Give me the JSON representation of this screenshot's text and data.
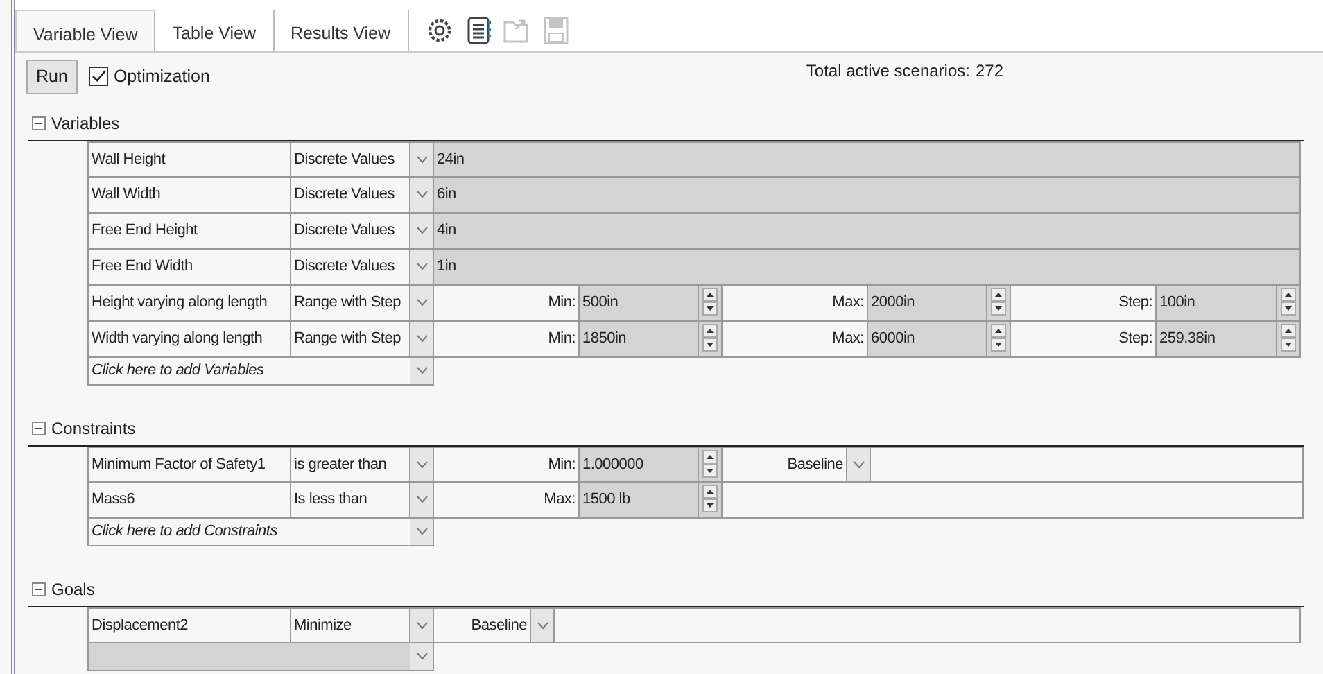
{
  "tabs": [
    {
      "label": "Variable View",
      "selected": true
    },
    {
      "label": "Table View",
      "selected": false
    },
    {
      "label": "Results View",
      "selected": false
    }
  ],
  "toolbar": [
    {
      "kind": "settings",
      "disabled": false
    },
    {
      "kind": "notes",
      "disabled": false
    },
    {
      "kind": "export",
      "disabled": true
    },
    {
      "kind": "save",
      "disabled": true
    }
  ],
  "run_button": "Run",
  "optimization": {
    "label": "Optimization",
    "checked": true
  },
  "total_scenarios": {
    "label": "Total active scenarios:",
    "value": "272"
  },
  "sections": [
    {
      "title": "Variables",
      "expanded": true,
      "rows": [
        {
          "kind": "discrete",
          "name": "Wall Height",
          "type": "Discrete Values",
          "value": "24in"
        },
        {
          "kind": "discrete",
          "name": "Wall Width",
          "type": "Discrete Values",
          "value": "6in"
        },
        {
          "kind": "discrete",
          "name": "Free End Height",
          "type": "Discrete Values",
          "value": "4in"
        },
        {
          "kind": "discrete",
          "name": "Free End Width",
          "type": "Discrete Values",
          "value": "1in"
        },
        {
          "kind": "range",
          "name": "Height varying along length",
          "type": "Range with Step",
          "fields": [
            {
              "label": "Min:",
              "value": "500in"
            },
            {
              "label": "Max:",
              "value": "2000in"
            },
            {
              "label": "Step:",
              "value": "100in"
            }
          ]
        },
        {
          "kind": "range",
          "name": "Width varying along length",
          "type": "Range with Step",
          "fields": [
            {
              "label": "Min:",
              "value": "1850in"
            },
            {
              "label": "Max:",
              "value": "6000in"
            },
            {
              "label": "Step:",
              "value": "259.38in"
            }
          ]
        }
      ],
      "add_row": {
        "enabled": true,
        "text": "Click here to add Variables"
      }
    },
    {
      "title": "Constraints",
      "expanded": true,
      "rows": [
        {
          "kind": "constraint",
          "name": "Minimum Factor of Safety1",
          "type": "is greater than",
          "fields": [
            {
              "label": "Min:",
              "value": "1.000000"
            }
          ],
          "baseline": "Baseline"
        },
        {
          "kind": "constraint",
          "name": "Mass6",
          "type": "Is less than",
          "fields": [
            {
              "label": "Max:",
              "value": "1500 lb"
            }
          ]
        }
      ],
      "add_row": {
        "enabled": true,
        "text": "Click here to add Constraints"
      }
    },
    {
      "title": "Goals",
      "expanded": true,
      "rows": [
        {
          "kind": "goal",
          "name": "Displacement2",
          "type": "Minimize",
          "baseline": "Baseline"
        }
      ],
      "add_row": {
        "enabled": false
      }
    }
  ]
}
